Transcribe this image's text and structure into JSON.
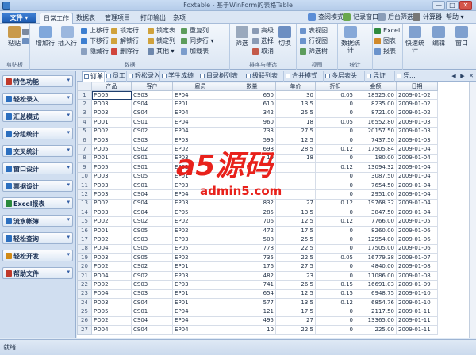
{
  "window": {
    "title": "Foxtable - 基于WinForm的表格Table",
    "min": "—",
    "max": "□",
    "close": "✕"
  },
  "menubar": {
    "file": "文件 ▾",
    "tabs": [
      "日常工作",
      "数据表",
      "管理项目",
      "打印输出",
      "杂项"
    ],
    "right": [
      "查阅模式",
      "记录窗口",
      "后台筛选",
      "计算器",
      "帮助 ▾"
    ]
  },
  "ribbon": {
    "clipboard": {
      "paste": "粘贴",
      "label": "剪贴板"
    },
    "data": {
      "add_row": "增加行",
      "insert_row": "插入行",
      "move_up": "上移行",
      "move_down": "下移行",
      "hide_row": "隐藏行",
      "lock_row": "锁定行",
      "unlock_row": "解锁行",
      "delete_row": "删除行",
      "lock_table": "锁定表",
      "lock_col": "锁定列",
      "repeat_fill": "重复列",
      "sync": "同步行 ▾",
      "other": "其他 ▾",
      "append_sheet": "加载表",
      "label": "数据"
    },
    "sort": {
      "filter": "筛选",
      "advanced": "高级",
      "select": "选择",
      "cancel": "取消",
      "sort": "切换",
      "label": "排序与筛选"
    },
    "view": {
      "table_view": "表视图",
      "row_view": "行视图",
      "all_filter": "筛选树",
      "label": "视图"
    },
    "stats": {
      "stats": "数据统计",
      "chart": "图表",
      "report": "报表",
      "excel": "Excel",
      "label": "统计"
    },
    "quick": {
      "quick": "快速统计",
      "edit": "编辑",
      "window": "窗口"
    }
  },
  "sidebar": [
    {
      "label": "特色功能",
      "color": "#c0392b"
    },
    {
      "label": "轻松录入",
      "color": "#2c6fbf"
    },
    {
      "label": "汇总模式",
      "color": "#2c6fbf"
    },
    {
      "label": "分组统计",
      "color": "#2c6fbf"
    },
    {
      "label": "交叉统计",
      "color": "#2c6fbf"
    },
    {
      "label": "窗口设计",
      "color": "#2c6fbf"
    },
    {
      "label": "票据设计",
      "color": "#2c6fbf"
    },
    {
      "label": "Excel报表",
      "color": "#2a8a3c"
    },
    {
      "label": "流水帐簿",
      "color": "#2c6fbf"
    },
    {
      "label": "轻松查询",
      "color": "#2c6fbf"
    },
    {
      "label": "轻松开发",
      "color": "#d18a16"
    },
    {
      "label": "帮助文件",
      "color": "#c0392b"
    }
  ],
  "tabs": [
    "订单",
    "员工",
    "轻松录入",
    "学生成绩",
    "目录树列表",
    "级联列表",
    "合并模式",
    "多层表头",
    "凭证",
    "凭..."
  ],
  "grid": {
    "columns": [
      "产品",
      "客户",
      "雇员",
      "数量",
      "单价",
      "折扣",
      "金额",
      "日期"
    ],
    "rows": [
      [
        "PD05",
        "CS03",
        "EP04",
        "650",
        "30",
        "0.05",
        "18525.00",
        "2009-01-02"
      ],
      [
        "PD03",
        "CS04",
        "EP01",
        "610",
        "13.5",
        "0",
        "8235.00",
        "2009-01-02"
      ],
      [
        "PD03",
        "CS04",
        "EP04",
        "342",
        "25.5",
        "0",
        "8721.00",
        "2009-01-02"
      ],
      [
        "PD01",
        "CS01",
        "EP04",
        "960",
        "18",
        "0.05",
        "16552.80",
        "2009-01-03"
      ],
      [
        "PD02",
        "CS02",
        "EP04",
        "733",
        "27.5",
        "0",
        "20157.50",
        "2009-01-03"
      ],
      [
        "PD03",
        "CS03",
        "EP03",
        "595",
        "12.5",
        "0",
        "7437.50",
        "2009-01-03"
      ],
      [
        "PD05",
        "CS02",
        "EP02",
        "698",
        "28.5",
        "0.12",
        "17505.84",
        "2009-01-04"
      ],
      [
        "PD01",
        "CS01",
        "EP03",
        "10",
        "18",
        "0",
        "180.00",
        "2009-01-04"
      ],
      [
        "PD05",
        "CS01",
        "EP02",
        "",
        "",
        "0.12",
        "13094.32",
        "2009-01-04"
      ],
      [
        "PD03",
        "CS05",
        "EP01",
        "",
        "",
        "0",
        "3087.50",
        "2009-01-04"
      ],
      [
        "PD03",
        "CS01",
        "EP03",
        "",
        "",
        "0",
        "7654.50",
        "2009-01-04"
      ],
      [
        "PD03",
        "CS04",
        "EP04",
        "",
        "",
        "0",
        "2951.00",
        "2009-01-04"
      ],
      [
        "PD02",
        "CS04",
        "EP03",
        "832",
        "27",
        "0.12",
        "19768.32",
        "2009-01-04"
      ],
      [
        "PD03",
        "CS04",
        "EP05",
        "285",
        "13.5",
        "0",
        "3847.50",
        "2009-01-04"
      ],
      [
        "PD02",
        "CS02",
        "EP02",
        "706",
        "12.5",
        "0.12",
        "7766.00",
        "2009-01-05"
      ],
      [
        "PD01",
        "CS05",
        "EP02",
        "472",
        "17.5",
        "0",
        "8260.00",
        "2009-01-06"
      ],
      [
        "PD02",
        "CS03",
        "EP03",
        "508",
        "25.5",
        "0",
        "12954.00",
        "2009-01-06"
      ],
      [
        "PD04",
        "CS05",
        "EP05",
        "778",
        "22.5",
        "0",
        "17505.00",
        "2009-01-06"
      ],
      [
        "PD03",
        "CS05",
        "EP02",
        "735",
        "22.5",
        "0.05",
        "16779.38",
        "2009-01-07"
      ],
      [
        "PD02",
        "CS02",
        "EP01",
        "176",
        "27.5",
        "0",
        "4840.00",
        "2009-01-08"
      ],
      [
        "PD04",
        "CS02",
        "EP03",
        "482",
        "23",
        "0",
        "11086.00",
        "2009-01-08"
      ],
      [
        "PD02",
        "CS03",
        "EP03",
        "741",
        "26.5",
        "0.15",
        "16691.03",
        "2009-01-09"
      ],
      [
        "PD04",
        "CS03",
        "EP01",
        "654",
        "12.5",
        "0.15",
        "6948.75",
        "2009-01-10"
      ],
      [
        "PD03",
        "CS04",
        "EP01",
        "577",
        "13.5",
        "0.12",
        "6854.76",
        "2009-01-10"
      ],
      [
        "PD05",
        "CS01",
        "EP04",
        "121",
        "17.5",
        "0",
        "2117.50",
        "2009-01-11"
      ],
      [
        "PD02",
        "CS04",
        "EP04",
        "495",
        "27",
        "0",
        "13365.00",
        "2009-01-11"
      ],
      [
        "PD04",
        "CS04",
        "EP04",
        "10",
        "22.5",
        "0",
        "225.00",
        "2009-01-11"
      ]
    ]
  },
  "status": "就绪",
  "watermark": {
    "logo": "a5源码",
    "url": "admin5.com"
  }
}
